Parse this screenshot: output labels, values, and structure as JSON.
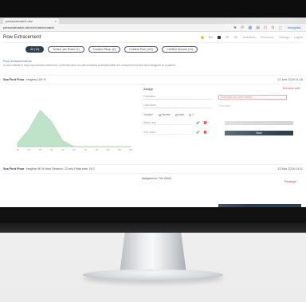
{
  "browser": {
    "tab_label": "personalmatch.dev",
    "tab_close": "×",
    "url": "personalmatch.dev/ch/match/match/",
    "icons": [
      "★",
      "⟳",
      "▦",
      "▤",
      "⊡",
      "⚙",
      "◻"
    ],
    "profile_label": "Incognito"
  },
  "app": {
    "title": "Row Extracement",
    "menus": [
      "EN",
      "FR",
      "DE",
      "Incentives",
      "Ressource",
      "Settings",
      "Logout"
    ]
  },
  "filters": [
    {
      "label": "All (13)",
      "active": true
    },
    {
      "label": "Sched. per Room (1)",
      "active": false
    },
    {
      "label": "Confirm Resp. (2)",
      "active": false
    },
    {
      "label": "Confirm Pool (121)",
      "active": false
    },
    {
      "label": "Confirm Second (11)",
      "active": false
    }
  ],
  "notice": {
    "title": "Row measurements",
    "text": "to view details in only unprocessed reference, confirmed and non-dimensioned evaluated after the measurement has been assigned to a patient."
  },
  "record1": {
    "left": "Sea First Floor",
    "meta": "Heights 100 %",
    "date": "22 Mar 2018 11:16",
    "assign": "Assign",
    "remove": "Remove unit",
    "firstname_label": "Firstname",
    "firstname_value": "Firstname last name repeat",
    "lastname_label": "Last name",
    "lastname_placeholder": "First name",
    "gender_label": "Gender*",
    "gender_options": [
      "Female",
      "Male",
      "X"
    ],
    "checks": [
      "Strike only",
      "Sort order"
    ],
    "submit": "Save"
  },
  "chart_data": {
    "type": "area",
    "x": [
      10,
      20,
      30,
      40,
      50,
      60,
      70,
      80,
      90,
      100,
      110
    ],
    "values": [
      4,
      18,
      38,
      26,
      6,
      0,
      0,
      0,
      0,
      0,
      0
    ],
    "tick_labels": [
      "10",
      "20",
      "30",
      "40",
      "50",
      "60",
      "70",
      "80",
      "90",
      "100",
      "110"
    ],
    "xlabel": "",
    "ylabel": "",
    "color": "#bfe3c8"
  },
  "record2": {
    "left": "Sea First Floor",
    "meta": "Heights 96 %  Next Session: 12 min  Plate time 14:2",
    "date": "13 Mar 2018 13:11",
    "assigned": "Assigned to: Tim Gillert",
    "remove": "Reassign"
  }
}
